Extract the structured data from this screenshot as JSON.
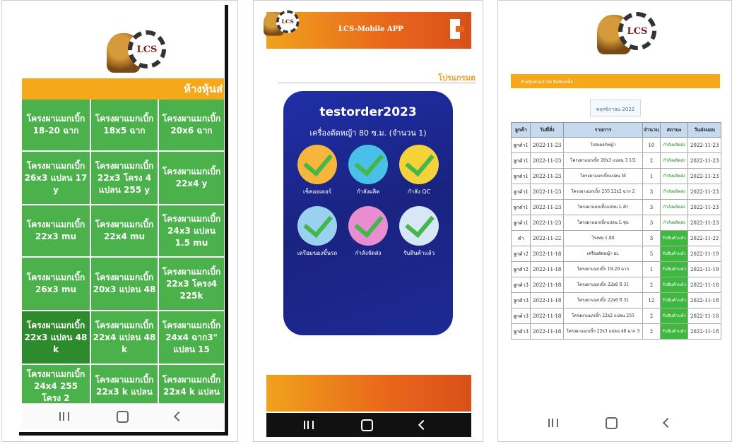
{
  "phone1": {
    "banner": "ห้างหุ้นส่",
    "grid": [
      [
        "โครงผาแมกเบิ้ก 18-20 ฉาก",
        "โครงผาแมกเบิ้ก 18x5 ฉาก",
        "โครงผาแมกเบิ้ก 20x6 ฉาก"
      ],
      [
        "โครงผาแมกเบิ้ก 26x3 แปลน 17 y",
        "โครงผาแมกเบิ้ก 22x3 โครง 4 แปลน 255 y",
        "โครงผาแมกเบิ้ก 22x4 y"
      ],
      [
        "โครงผาแมกเบิ้ก 22x3 mu",
        "โครงผาแมกเบิ้ก 22x4 mu",
        "โครงผาแมกเบิ้ก 24x3 แปลน 1.5 mu"
      ],
      [
        "โครงผาแมกเบิ้ก 26x3 mu",
        "โครงผาแมกเบิ้ก 20x3 แปลน 48",
        "โครงผาแมกเบิ้ก 22x3 โครง4 225k"
      ],
      [
        "โครงผาแมกเบิ้ก 22x3 แปลน 48 k",
        "โครงผาแมกเบิ้ก 22x4 แปลน 48 k",
        "โครงผาแมกเบิ้ก 24x4 ฉาก3\" แปลน 15"
      ],
      [
        "โครงผาแมกเบิ้ก 24x4 255 โครง 2",
        "โครงผาแมกเบิ้ก 22x3 k แปลน",
        "โครงผาแมกเบิ้ก 22x4 k แปลน"
      ]
    ]
  },
  "phone2": {
    "app_title": "LCS-Mobile APP",
    "program_label": "โปรแกรมต",
    "username": "testorder2023",
    "machine": "เครื่องตัดหญ้า 80 ซ.ม. (จำนวน 1)",
    "menu": [
      {
        "label": "เช็คออเดอร์",
        "color": "#f6b53b"
      },
      {
        "label": "กำลังผลิต",
        "color": "#49c0e8"
      },
      {
        "label": "กำลัง QC",
        "color": "#f4d33a"
      },
      {
        "label": "เตรียมของขึ้นรถ",
        "color": "#9ad1f0"
      },
      {
        "label": "กำลังจัดส่ง",
        "color": "#e88dd0"
      },
      {
        "label": "รับสินค้าแล้ว",
        "color": "#d7e7f6"
      }
    ]
  },
  "phone3": {
    "banner": "ห้างหุ้นส่วนจำกัด ลือชัยเหล็ก",
    "date_label": "พฤศจิกายน 2022",
    "columns": [
      "ลูกค้า",
      "วันที่สั่ง",
      "รายการ",
      "จำนวน",
      "สถานะ",
      "วันส่งมอบ"
    ],
    "rows": [
      [
        "ลูกค้า1",
        "2022-11-23",
        "โปสเตอร์หญ้า",
        "10",
        "กำลังผลิตส่ง",
        "2022-11-23"
      ],
      [
        "ลูกค้า1",
        "2022-11-23",
        "โครงผาแมกเบิ้ก 26x3 แปลน 3 1/2",
        "2",
        "กำลังผลิตส่ง",
        "2022-11-23"
      ],
      [
        "ลูกค้า1",
        "2022-11-23",
        "โครงผาแมกเบิ้กแปลน M",
        "1",
        "กำลังผลิตส่ง",
        "2022-11-23"
      ],
      [
        "ลูกค้า1",
        "2022-11-23",
        "โครงผาแมกเบิ้ก 255 22x2 ฉาก 2",
        "3",
        "กำลังผลิตส่ง",
        "2022-11-23"
      ],
      [
        "ลูกค้า1",
        "2022-11-23",
        "โครงผาแมกเบิ้กแปลน L ดำ",
        "3",
        "กำลังผลิตส่ง",
        "2022-11-23"
      ],
      [
        "ลูกค้า1",
        "2022-11-23",
        "โครงผาแมกเบิ้กแปลน L ชุบ",
        "3",
        "กำลังผลิตส่ง",
        "2022-11-23"
      ],
      [
        "ดำ",
        "2022-11-22",
        "โรงท่อ 1.80",
        "3",
        "รับสินค้าแล้ว",
        "2022-11-22"
      ],
      [
        "ลูกค้า2",
        "2022-11-18",
        "เครื่องตัดหญ้า m.",
        "5",
        "รับสินค้าแล้ว",
        "2022-11-19"
      ],
      [
        "ลูกค้า2",
        "2022-11-18",
        "โครงผาแมกเบิ้ก 18-20 ฉาก",
        "1",
        "รับสินค้าแล้ว",
        "2022-11-19"
      ],
      [
        "ลูกค้า3",
        "2022-11-18",
        "โครงผาแมกเบิ้ก 22x6 ปี 31",
        "2",
        "รับสินค้าแล้ว",
        "2022-11-18"
      ],
      [
        "ลูกค้า3",
        "2022-11-18",
        "โครงผาแมกเบิ้ก 22x6 ปี 31",
        "12",
        "รับสินค้าแล้ว",
        "2022-11-18"
      ],
      [
        "ลูกค้า3",
        "2022-11-18",
        "โครงผาแมกเบิ้ก 22x2 แปลน 255",
        "2",
        "รับสินค้าแล้ว",
        "2022-11-18"
      ],
      [
        "ลูกค้า3",
        "2022-11-18",
        "โครงผาแมกเบิ้ก 22x3 แปลน 48 ฉาก 3",
        "2",
        "รับสินค้าแล้ว",
        "2022-11-18"
      ]
    ]
  },
  "logo_text": "LCS",
  "colors": {
    "orange": "#f4a81a",
    "green": "#4bb14a",
    "navy": "#1a2380",
    "header_blue": "#c5d9ef"
  }
}
